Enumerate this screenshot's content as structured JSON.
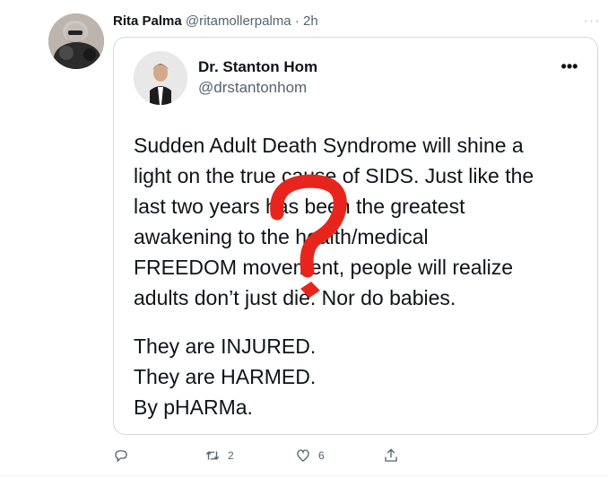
{
  "tweet": {
    "author_name": "Rita Palma",
    "author_handle": "@ritamollerpalma",
    "separator": "·",
    "time": "2h",
    "more_label": "···"
  },
  "quoted": {
    "author_name": "Dr. Stanton Hom",
    "author_handle": "@drstantonhom",
    "more_label": "•••",
    "lines": [
      "Sudden Adult Death Syndrome will shine a",
      "light on the true cause of SIDS. Just like the",
      "last two years has been the greatest",
      "awakening to the health/medical",
      "FREEDOM movement, people will realize",
      "adults don’t just die. Nor do babies."
    ],
    "lines2": [
      "They are INJURED.",
      "They are HARMED.",
      "By pHARMa."
    ],
    "overlay_color": "#e8251c"
  },
  "actions": {
    "reply": {
      "icon": "reply-icon",
      "count": ""
    },
    "retweet": {
      "icon": "retweet-icon",
      "count": "2"
    },
    "like": {
      "icon": "heart-icon",
      "count": "6"
    },
    "share": {
      "icon": "share-icon",
      "count": ""
    }
  },
  "colors": {
    "secondary_text": "#536471",
    "border": "#cfd9de"
  }
}
